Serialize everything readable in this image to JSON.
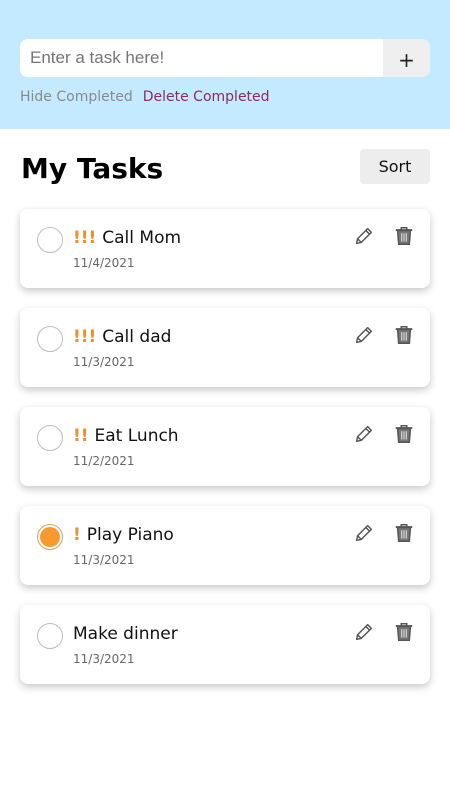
{
  "input": {
    "placeholder": "Enter a task here!",
    "value": "",
    "add_label": "+"
  },
  "links": {
    "hide_completed": "Hide Completed",
    "delete_completed": "Delete Completed"
  },
  "list": {
    "title": "My Tasks",
    "sort_label": "Sort"
  },
  "colors": {
    "header_bg": "#c4eaff",
    "priority": "#f28c28",
    "checked": "#f79a2e",
    "delete_link": "#8a2e57"
  },
  "icons": {
    "edit": "pencil-icon",
    "delete": "trash-icon",
    "status": "checkbox-circle"
  },
  "tasks": [
    {
      "priority": "!!!",
      "name": "Call Mom",
      "date": "11/4/2021",
      "completed": false
    },
    {
      "priority": "!!!",
      "name": "Call dad",
      "date": "11/3/2021",
      "completed": false
    },
    {
      "priority": "!!",
      "name": "Eat Lunch",
      "date": "11/2/2021",
      "completed": false
    },
    {
      "priority": "!",
      "name": "Play Piano",
      "date": "11/3/2021",
      "completed": true
    },
    {
      "priority": "",
      "name": "Make dinner",
      "date": "11/3/2021",
      "completed": false
    }
  ]
}
